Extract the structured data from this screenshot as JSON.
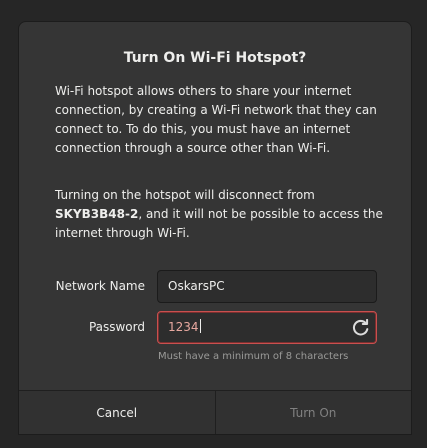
{
  "dialog": {
    "title": "Turn On Wi-Fi Hotspot?",
    "description": "Wi-Fi hotspot allows others to share your internet connection, by creating a Wi-Fi network that they can connect to. To do this, you must have an internet connection through a source other than Wi-Fi.",
    "warning_prefix": "Turning on the hotspot will disconnect from ",
    "current_network": "SKYB3B48-2",
    "warning_suffix": ", and it will not be possible to access the internet through Wi-Fi."
  },
  "form": {
    "network_name_label": "Network Name",
    "network_name_value": "OskarsPC",
    "password_label": "Password",
    "password_value": "1234",
    "password_hint": "Must have a minimum of 8 characters",
    "password_refresh_icon": "refresh-icon",
    "password_error_color": "#c9504f"
  },
  "buttons": {
    "cancel_label": "Cancel",
    "turn_on_label": "Turn On"
  }
}
